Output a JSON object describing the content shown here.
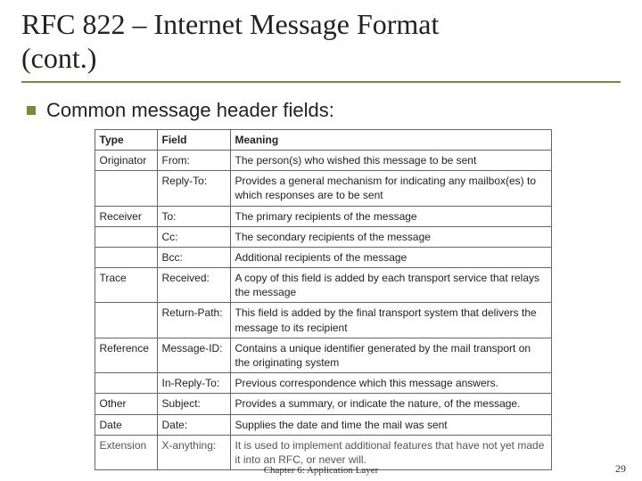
{
  "title_line1": "RFC 822 – Internet Message Format",
  "title_line2": "(cont.)",
  "bullet_text": "Common message header fields:",
  "table": {
    "headers": {
      "type": "Type",
      "field": "Field",
      "meaning": "Meaning"
    },
    "rows": [
      {
        "type": "Originator",
        "field": "From:",
        "meaning": "The person(s) who wished this message to be sent"
      },
      {
        "type": "",
        "field": "Reply-To:",
        "meaning": "Provides a general mechanism for indicating any mailbox(es) to which responses are to be sent"
      },
      {
        "type": "Receiver",
        "field": "To:",
        "meaning": "The primary recipients of the message"
      },
      {
        "type": "",
        "field": "Cc:",
        "meaning": "The secondary recipients of the message"
      },
      {
        "type": "",
        "field": "Bcc:",
        "meaning": "Additional recipients of the message"
      },
      {
        "type": "Trace",
        "field": "Received:",
        "meaning": "A copy of this field is added by each transport service that relays the message"
      },
      {
        "type": "",
        "field": "Return-Path:",
        "meaning": "This field is added by the final transport system that delivers the message to its recipient"
      },
      {
        "type": "Reference",
        "field": "Message-ID:",
        "meaning": "Contains a unique identifier generated by the mail transport on the originating system"
      },
      {
        "type": "",
        "field": "In-Reply-To:",
        "meaning": "Previous correspondence which this message answers."
      },
      {
        "type": "Other",
        "field": "Subject:",
        "meaning": "Provides a summary, or indicate the       nature, of the message."
      },
      {
        "type": "Date",
        "field": "Date:",
        "meaning": "Supplies the date and time the mail was sent"
      },
      {
        "type": "Extension",
        "field": "X-anything:",
        "meaning": "It is used to implement additional features that have not yet made it into an RFC, or never will."
      }
    ]
  },
  "footer": "Chapter 6: Application Layer",
  "page_number": "29"
}
